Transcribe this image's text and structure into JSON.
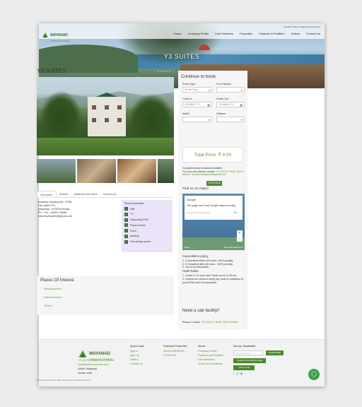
{
  "brand": {
    "name": "WAYANAD",
    "tagline": "AMBIENCE HOMES"
  },
  "header": {
    "contact": "+91 8472 7564 | info@ambiencehomes",
    "nav": [
      "Home",
      "Company Profile",
      "Club Members",
      "Properties",
      "Features & Facilities",
      "Gallery",
      "Contact Us"
    ]
  },
  "hero": {
    "title": "Y3 SUITES"
  },
  "listing": {
    "title": "Y3 SUITES",
    "rating_stars": "★★★★★"
  },
  "tabs": [
    "Description",
    "Address",
    "Additional Information",
    "Reviews (0)"
  ],
  "address": {
    "lines": [
      "Address: Building No. 7/395,",
      "Old Vythiri PO,",
      "Wayanad - 673576 Kerala,",
      "Ph.: +91 - (0491) 76646",
      "resorts.y3suites@gmail.com"
    ]
  },
  "amenities": {
    "heading": "Room Amenities",
    "items": [
      "Wifi",
      "TV",
      "Swimming Pool",
      "Room heater",
      "Food",
      "parking",
      "Sea-acting locker"
    ]
  },
  "poi": {
    "title": "Places Of Interest",
    "links": [
      "Restaurants ▾",
      "Petrol Pump ▾",
      "ATM ▾"
    ]
  },
  "booking": {
    "title": "Continue to book",
    "room_type_label": "Room Type",
    "room_type_value": "Room Type",
    "rooms_label": "No.of Rooms",
    "checkin_label": "Check In",
    "checkin_placeholder": "DD/MM/YYYY",
    "checkout_label": "Check Out",
    "checkout_placeholder": "DD/MM/YYYY",
    "adults_label": "Adults",
    "children_label": "Children",
    "total": "Total Price: ₹ 0.00",
    "note": "Complementary breakfast available",
    "note2": "For more info please contact",
    "phone": "+91 (0472) 70646, 98470",
    "email": "55455 / resortsonwayanad@gmail.com",
    "button": "CONTINUE"
  },
  "map": {
    "title": "Find us on maps!",
    "dialog_title": "Google",
    "dialog_text": "This page can't load Google Maps correctly.",
    "dialog_sub": "Do you own this website?",
    "ok": "OK",
    "footer_left": "Google",
    "footer_right": "Map data ©2025 Terms"
  },
  "policy": {
    "heading": "Cancellation policy",
    "lines": [
      "1. If cancelled before 48 hours : 50% penalty.",
      "2. If Cancelled after 48 hours : 100% penalty.",
      "3. Tax is not refundable."
    ],
    "rules_heading": "Hotel Rules",
    "rules": [
      "1. Check In 12 noon and Check out at 11.00 am.",
      "2. Guests can check-in using any local or outstation ID proof (PAN card not accepted)."
    ]
  },
  "cab": {
    "title": "Need a cab facility!!",
    "contact_label": "Please Contact:",
    "contact": "+91 (0472) 70646, 98470 55455"
  },
  "footer": {
    "contact_lines": [
      "+91 (0472) 70646, 98470 55455",
      "info@ambiencehomes.com",
      "Vythiri, Wayanad,",
      "Kerala, India"
    ],
    "quick_links_heading": "Quick Links",
    "quick_links": [
      "Sign In",
      "Sign Up",
      "Gallery",
      "Contact Us"
    ],
    "featured_heading": "Featured Properties",
    "featured": [
      "PALM CORRIDNS",
      "Y3 SUITES"
    ],
    "about_heading": "About",
    "about": [
      "Company Profile",
      "Features and Facilities",
      "Club Members",
      "Terms and Conditions"
    ],
    "newsletter_heading": "Get our Newsletter",
    "newsletter_placeholder": "Your email here",
    "subscribe": "SUBSCRIBE",
    "download_btn": "DOWNLOAD BROCHURE",
    "join_btn": "JOIN CLUB",
    "copyright": "Designed and hosted by DMC | Powered by infra Solutions Pvt Ltd"
  },
  "colors": {
    "accent": "#5a9a2a",
    "button": "#4a8a2a",
    "amenity_bg": "#ebe4f8"
  }
}
